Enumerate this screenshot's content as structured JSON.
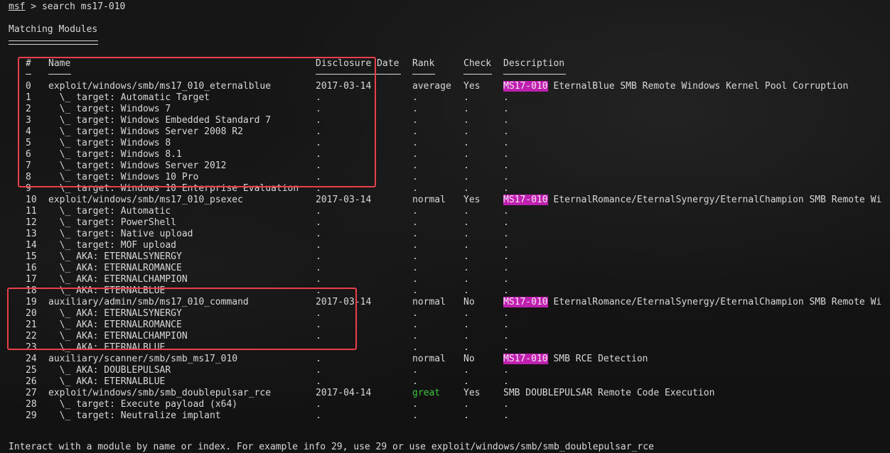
{
  "command": {
    "prompt": "msf",
    "separator": " > ",
    "text": "search ms17-010"
  },
  "section_title": "Matching Modules",
  "headers": {
    "num": "#",
    "name": "Name",
    "date": "Disclosure Date",
    "rank": "Rank",
    "check": "Check",
    "desc": "Description"
  },
  "rows": [
    {
      "num": "0",
      "name": "exploit/windows/smb/ms17_010_eternalblue",
      "date": "2017-03-14",
      "rank": "average",
      "check": "Yes",
      "tag": "MS17-010",
      "desc": " EternalBlue SMB Remote Windows Kernel Pool Corruption"
    },
    {
      "num": "1",
      "name": "  \\_ target: Automatic Target",
      "date": ".",
      "rank": ".",
      "check": ".",
      "tag": "",
      "desc": "."
    },
    {
      "num": "2",
      "name": "  \\_ target: Windows 7",
      "date": ".",
      "rank": ".",
      "check": ".",
      "tag": "",
      "desc": "."
    },
    {
      "num": "3",
      "name": "  \\_ target: Windows Embedded Standard 7",
      "date": ".",
      "rank": ".",
      "check": ".",
      "tag": "",
      "desc": "."
    },
    {
      "num": "4",
      "name": "  \\_ target: Windows Server 2008 R2",
      "date": ".",
      "rank": ".",
      "check": ".",
      "tag": "",
      "desc": "."
    },
    {
      "num": "5",
      "name": "  \\_ target: Windows 8",
      "date": ".",
      "rank": ".",
      "check": ".",
      "tag": "",
      "desc": "."
    },
    {
      "num": "6",
      "name": "  \\_ target: Windows 8.1",
      "date": ".",
      "rank": ".",
      "check": ".",
      "tag": "",
      "desc": "."
    },
    {
      "num": "7",
      "name": "  \\_ target: Windows Server 2012",
      "date": ".",
      "rank": ".",
      "check": ".",
      "tag": "",
      "desc": "."
    },
    {
      "num": "8",
      "name": "  \\_ target: Windows 10 Pro",
      "date": ".",
      "rank": ".",
      "check": ".",
      "tag": "",
      "desc": "."
    },
    {
      "num": "9",
      "name": "  \\_ target: Windows 10 Enterprise Evaluation",
      "date": ".",
      "rank": ".",
      "check": ".",
      "tag": "",
      "desc": "."
    },
    {
      "num": "10",
      "name": "exploit/windows/smb/ms17_010_psexec",
      "date": "2017-03-14",
      "rank": "normal",
      "check": "Yes",
      "tag": "MS17-010",
      "desc": " EternalRomance/EternalSynergy/EternalChampion SMB Remote Wi"
    },
    {
      "num": "11",
      "name": "  \\_ target: Automatic",
      "date": ".",
      "rank": ".",
      "check": ".",
      "tag": "",
      "desc": "."
    },
    {
      "num": "12",
      "name": "  \\_ target: PowerShell",
      "date": ".",
      "rank": ".",
      "check": ".",
      "tag": "",
      "desc": "."
    },
    {
      "num": "13",
      "name": "  \\_ target: Native upload",
      "date": ".",
      "rank": ".",
      "check": ".",
      "tag": "",
      "desc": "."
    },
    {
      "num": "14",
      "name": "  \\_ target: MOF upload",
      "date": ".",
      "rank": ".",
      "check": ".",
      "tag": "",
      "desc": "."
    },
    {
      "num": "15",
      "name": "  \\_ AKA: ETERNALSYNERGY",
      "date": ".",
      "rank": ".",
      "check": ".",
      "tag": "",
      "desc": "."
    },
    {
      "num": "16",
      "name": "  \\_ AKA: ETERNALROMANCE",
      "date": ".",
      "rank": ".",
      "check": ".",
      "tag": "",
      "desc": "."
    },
    {
      "num": "17",
      "name": "  \\_ AKA: ETERNALCHAMPION",
      "date": ".",
      "rank": ".",
      "check": ".",
      "tag": "",
      "desc": "."
    },
    {
      "num": "18",
      "name": "  \\_ AKA: ETERNALBLUE",
      "date": ".",
      "rank": ".",
      "check": ".",
      "tag": "",
      "desc": "."
    },
    {
      "num": "19",
      "name": "auxiliary/admin/smb/ms17_010_command",
      "date": "2017-03-14",
      "rank": "normal",
      "check": "No",
      "tag": "MS17-010",
      "desc": " EternalRomance/EternalSynergy/EternalChampion SMB Remote Wi"
    },
    {
      "num": "20",
      "name": "  \\_ AKA: ETERNALSYNERGY",
      "date": ".",
      "rank": ".",
      "check": ".",
      "tag": "",
      "desc": "."
    },
    {
      "num": "21",
      "name": "  \\_ AKA: ETERNALROMANCE",
      "date": ".",
      "rank": ".",
      "check": ".",
      "tag": "",
      "desc": "."
    },
    {
      "num": "22",
      "name": "  \\_ AKA: ETERNALCHAMPION",
      "date": ".",
      "rank": ".",
      "check": ".",
      "tag": "",
      "desc": "."
    },
    {
      "num": "23",
      "name": "  \\_ AKA: ETERNALBLUE",
      "date": ".",
      "rank": ".",
      "check": ".",
      "tag": "",
      "desc": "."
    },
    {
      "num": "24",
      "name": "auxiliary/scanner/smb/smb_ms17_010",
      "date": ".",
      "rank": "normal",
      "check": "No",
      "tag": "MS17-010",
      "desc": " SMB RCE Detection"
    },
    {
      "num": "25",
      "name": "  \\_ AKA: DOUBLEPULSAR",
      "date": ".",
      "rank": ".",
      "check": ".",
      "tag": "",
      "desc": "."
    },
    {
      "num": "26",
      "name": "  \\_ AKA: ETERNALBLUE",
      "date": ".",
      "rank": ".",
      "check": ".",
      "tag": "",
      "desc": "."
    },
    {
      "num": "27",
      "name": "exploit/windows/smb/smb_doublepulsar_rce",
      "date": "2017-04-14",
      "rank": "great",
      "check": "Yes",
      "tag": "",
      "desc": "SMB DOUBLEPULSAR Remote Code Execution"
    },
    {
      "num": "28",
      "name": "  \\_ target: Execute payload (x64)",
      "date": ".",
      "rank": ".",
      "check": ".",
      "tag": "",
      "desc": "."
    },
    {
      "num": "29",
      "name": "  \\_ target: Neutralize implant",
      "date": ".",
      "rank": ".",
      "check": ".",
      "tag": "",
      "desc": "."
    }
  ],
  "footer_line": "Interact with a module by name or index. For example info 29, use 29 or use exploit/windows/smb/smb_doublepulsar_rce",
  "colors": {
    "background": "#141414",
    "text": "#d8d8d8",
    "highlight": "#c020b0",
    "great_rank": "#3cc33c",
    "annotation_box": "#e8404a"
  }
}
